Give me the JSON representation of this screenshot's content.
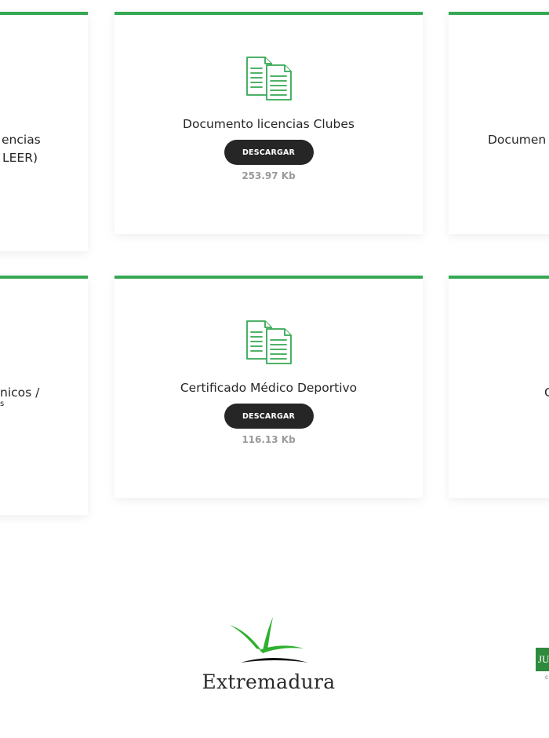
{
  "cards": [
    {
      "title": "Documento licencias Clubes",
      "button_label": "DESCARGAR",
      "size": "253.97 Kb"
    },
    {
      "title": "Certificado Médico Deportivo",
      "button_label": "DESCARGAR",
      "size": "116.13 Kb"
    }
  ],
  "partial_cards": {
    "left_top_line1": "encias",
    "left_top_line2": "LEER)",
    "right_top": "Documen",
    "left_bottom_line1": "nicos /",
    "left_bottom_line2": "s",
    "right_bottom": "C"
  },
  "footer": {
    "extremadura_logo_text": "Extremadura",
    "junta_logo_text": "JU",
    "junta_sub_text": "c"
  },
  "colors": {
    "accent_green": "#35a853",
    "button_dark": "#262626",
    "size_gray": "#9a9a9a"
  },
  "icons": {
    "card_icon": "documents-icon"
  }
}
